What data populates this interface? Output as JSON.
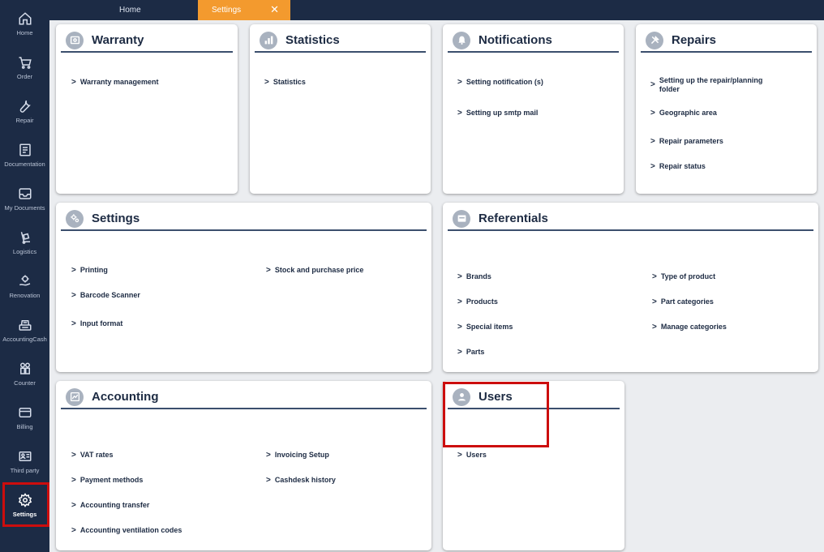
{
  "sidebar": {
    "items": [
      {
        "label": "Home",
        "icon": "home-icon"
      },
      {
        "label": "Order",
        "icon": "cart-icon"
      },
      {
        "label": "Repair",
        "icon": "wrench-icon"
      },
      {
        "label": "Documentation",
        "icon": "document-icon"
      },
      {
        "label": "My Documents",
        "icon": "inbox-icon"
      },
      {
        "label": "Logistics",
        "icon": "hand-truck-icon"
      },
      {
        "label": "Renovation",
        "icon": "gear-hand-icon"
      },
      {
        "label": "AccountingCash",
        "icon": "cash-register-icon"
      },
      {
        "label": "Counter",
        "icon": "people-icon"
      },
      {
        "label": "Billing",
        "icon": "credit-card-icon"
      },
      {
        "label": "Third party",
        "icon": "id-card-icon"
      },
      {
        "label": "Settings",
        "icon": "settings-gear-icon"
      }
    ]
  },
  "tabs": {
    "home": "Home",
    "settings": "Settings",
    "close": "✕"
  },
  "cards": {
    "warranty": {
      "title": "Warranty",
      "links": [
        "Warranty management"
      ]
    },
    "statistics": {
      "title": "Statistics",
      "links": [
        "Statistics"
      ]
    },
    "notifications": {
      "title": "Notifications",
      "links": [
        "Setting notification (s)",
        "Setting up smtp mail"
      ]
    },
    "repairs": {
      "title": "Repairs",
      "links": [
        "Setting up the repair/planning folder",
        "Geographic area",
        "Repair parameters",
        "Repair status"
      ]
    },
    "settings": {
      "title": "Settings",
      "links": [
        "Printing",
        "Barcode Scanner",
        "Input format",
        "Stock and purchase price"
      ]
    },
    "referentials": {
      "title": "Referentials",
      "links": [
        "Brands",
        "Products",
        "Special items",
        "Parts",
        "Type of product",
        "Part categories",
        "Manage categories"
      ]
    },
    "accounting": {
      "title": "Accounting",
      "links": [
        "VAT rates",
        "Payment methods",
        "Accounting transfer",
        "Accounting ventilation codes",
        "Invoicing Setup",
        "Cashdesk history"
      ]
    },
    "users": {
      "title": "Users",
      "links": [
        "Users"
      ]
    }
  },
  "colors": {
    "sidebar_bg": "#1c2b45",
    "tab_active": "#f39a2e",
    "highlight": "#cc0d0d",
    "card_title": "#1d2b43"
  }
}
